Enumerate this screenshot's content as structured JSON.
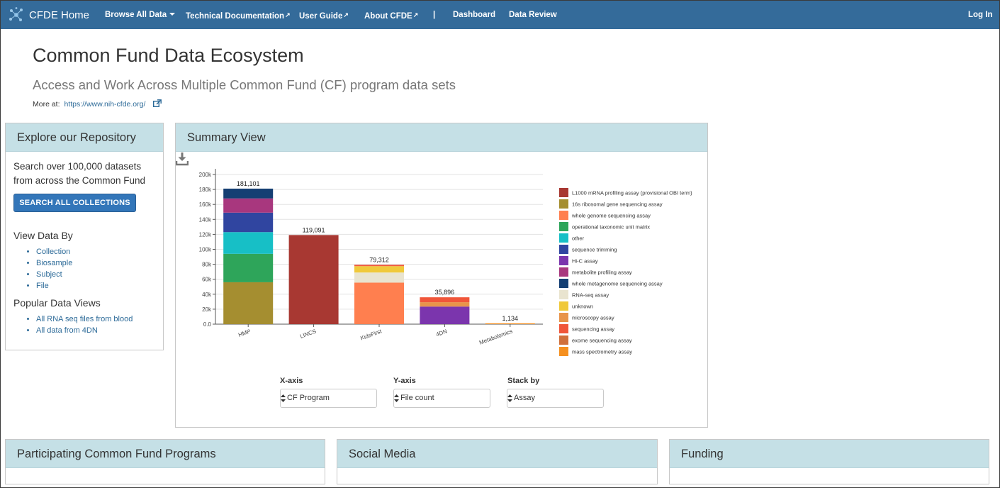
{
  "nav": {
    "brand": "CFDE Home",
    "items": [
      {
        "label": "Browse All Data",
        "dropdown": true
      },
      {
        "label": "Technical Documentation",
        "external": true
      },
      {
        "label": "User Guide",
        "external": true
      },
      {
        "label": "About CFDE",
        "external": true
      },
      {
        "label": "|"
      },
      {
        "label": "Dashboard"
      },
      {
        "label": "Data Review"
      }
    ],
    "login": "Log In"
  },
  "hero": {
    "title": "Common Fund Data Ecosystem",
    "subtitle": "Access and Work Across Multiple Common Fund (CF) program data sets",
    "more_label": "More at:",
    "more_link": "https://www.nih-cfde.org/"
  },
  "explore": {
    "title": "Explore our Repository",
    "description": "Search over 100,000 datasets from across the Common Fund",
    "search_button": "SEARCH ALL COLLECTIONS",
    "view_by_heading": "View Data By",
    "view_by": [
      "Collection",
      "Biosample",
      "Subject",
      "File"
    ],
    "popular_heading": "Popular Data Views",
    "popular": [
      "All RNA seq files from blood",
      "All data from 4DN"
    ]
  },
  "summary": {
    "title": "Summary View",
    "controls": {
      "x_label": "X-axis",
      "x_value": "CF Program",
      "y_label": "Y-axis",
      "y_value": "File count",
      "stack_label": "Stack by",
      "stack_value": "Assay"
    }
  },
  "chart_data": {
    "type": "bar",
    "stacked": true,
    "categories": [
      "HMP",
      "LINCS",
      "KidsFirst",
      "4DN",
      "Metabolomics"
    ],
    "totals": [
      181101,
      119091,
      79312,
      35896,
      1134
    ],
    "total_labels": [
      "181,101",
      "119,091",
      "79,312",
      "35,896",
      "1,134"
    ],
    "ylim": [
      0,
      200000
    ],
    "yticks": [
      0,
      20000,
      40000,
      60000,
      80000,
      100000,
      120000,
      140000,
      160000,
      180000,
      200000
    ],
    "ytick_labels": [
      "0.0",
      "20k",
      "40k",
      "60k",
      "80k",
      "100k",
      "120k",
      "140k",
      "160k",
      "180k",
      "200k"
    ],
    "legend_position": "right",
    "series": [
      {
        "name": "L1000 mRNA profiling assay (provisional OBI term)",
        "color": "#a83832",
        "values": [
          0,
          119091,
          0,
          0,
          0
        ]
      },
      {
        "name": "16s ribosomal gene sequencing assay",
        "color": "#a58e30",
        "values": [
          56000,
          0,
          0,
          0,
          0
        ]
      },
      {
        "name": "whole genome sequencing assay",
        "color": "#ff7f4f",
        "values": [
          0,
          0,
          55500,
          0,
          0
        ]
      },
      {
        "name": "operational taxonomic unit matrix",
        "color": "#2ea55a",
        "values": [
          38000,
          0,
          0,
          0,
          0
        ]
      },
      {
        "name": "other",
        "color": "#17bfc6",
        "values": [
          29000,
          0,
          0,
          0,
          0
        ]
      },
      {
        "name": "sequence trimming",
        "color": "#3045a0",
        "values": [
          26000,
          0,
          0,
          0,
          0
        ]
      },
      {
        "name": "Hi-C assay",
        "color": "#7b35ad",
        "values": [
          0,
          0,
          0,
          23500,
          0
        ]
      },
      {
        "name": "metabolite profiling assay",
        "color": "#a8377e",
        "values": [
          19000,
          0,
          0,
          0,
          0
        ]
      },
      {
        "name": "whole metagenome sequencing assay",
        "color": "#153f73",
        "values": [
          13101,
          0,
          0,
          0,
          0
        ]
      },
      {
        "name": "RNA-seq assay",
        "color": "#e9e4cf",
        "values": [
          0,
          0,
          13500,
          0,
          0
        ]
      },
      {
        "name": "unknown",
        "color": "#f0c93a",
        "values": [
          0,
          0,
          8500,
          0,
          0
        ]
      },
      {
        "name": "microscopy assay",
        "color": "#e8944a",
        "values": [
          0,
          0,
          0,
          5800,
          0
        ]
      },
      {
        "name": "sequencing assay",
        "color": "#f0563a",
        "values": [
          0,
          0,
          1812,
          6596,
          0
        ]
      },
      {
        "name": "exome sequencing assay",
        "color": "#d0703c",
        "values": [
          0,
          0,
          0,
          0,
          0
        ]
      },
      {
        "name": "mass spectrometry assay",
        "color": "#f59020",
        "values": [
          0,
          0,
          0,
          0,
          1134
        ]
      }
    ]
  },
  "bottom_panels": [
    "Participating Common Fund Programs",
    "Social Media",
    "Funding"
  ]
}
